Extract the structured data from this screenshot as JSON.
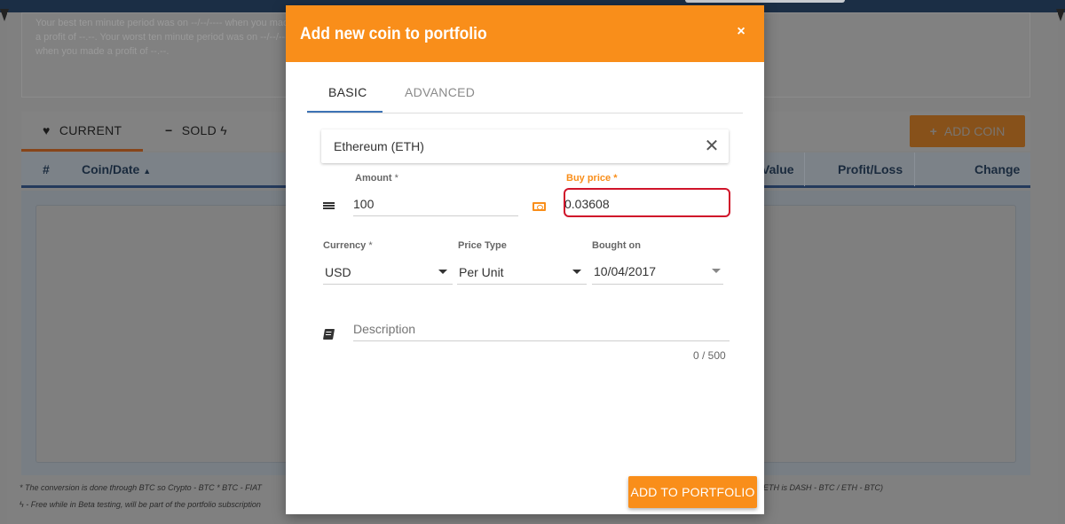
{
  "background": {
    "summary_text": "Your best ten minute period was on --/--/---- when you made a profit of --.--. Your worst ten minute period was on --/--/---- when you made a profit of --.--.",
    "tabs": [
      {
        "label": "CURRENT",
        "icon": "heartbeat-icon"
      },
      {
        "label": "SOLD",
        "icon": "bolt-icon"
      }
    ],
    "add_coin_label": "ADD COIN",
    "table_headers": [
      "#",
      "Coin/Date",
      "Value",
      "Profit/Loss",
      "Change"
    ],
    "footnote_1_left": "* The conversion is done through BTC so Crypto - BTC * BTC - FIAT",
    "footnote_1_right": "ETH is DASH - BTC / ETH - BTC)",
    "footnote_2": "- Free while in Beta testing, will be part of the portfolio subscription",
    "colors": {
      "nav": "#1b2e45",
      "accent": "#f98e1a"
    }
  },
  "modal": {
    "title": "Add new coin to portfolio",
    "close_symbol": "×",
    "tabs": [
      {
        "label": "BASIC",
        "active": true
      },
      {
        "label": "ADVANCED",
        "active": false
      }
    ],
    "coin": {
      "value": "Ethereum (ETH)",
      "clear_symbol": "✕"
    },
    "amount": {
      "label": "Amount",
      "required_mark": "*",
      "value": "100"
    },
    "buy_price": {
      "label": "Buy price",
      "required_mark": "*",
      "value": "0.03608"
    },
    "currency": {
      "label": "Currency",
      "required_mark": "*",
      "value": "USD"
    },
    "price_type": {
      "label": "Price Type",
      "value": "Per Unit"
    },
    "bought_on": {
      "label": "Bought on",
      "value": "10/04/2017"
    },
    "description": {
      "placeholder": "Description",
      "value": "",
      "counter": "0 / 500"
    },
    "submit_label": "ADD TO PORTFOLIO",
    "accent_color": "#f98e1a"
  }
}
